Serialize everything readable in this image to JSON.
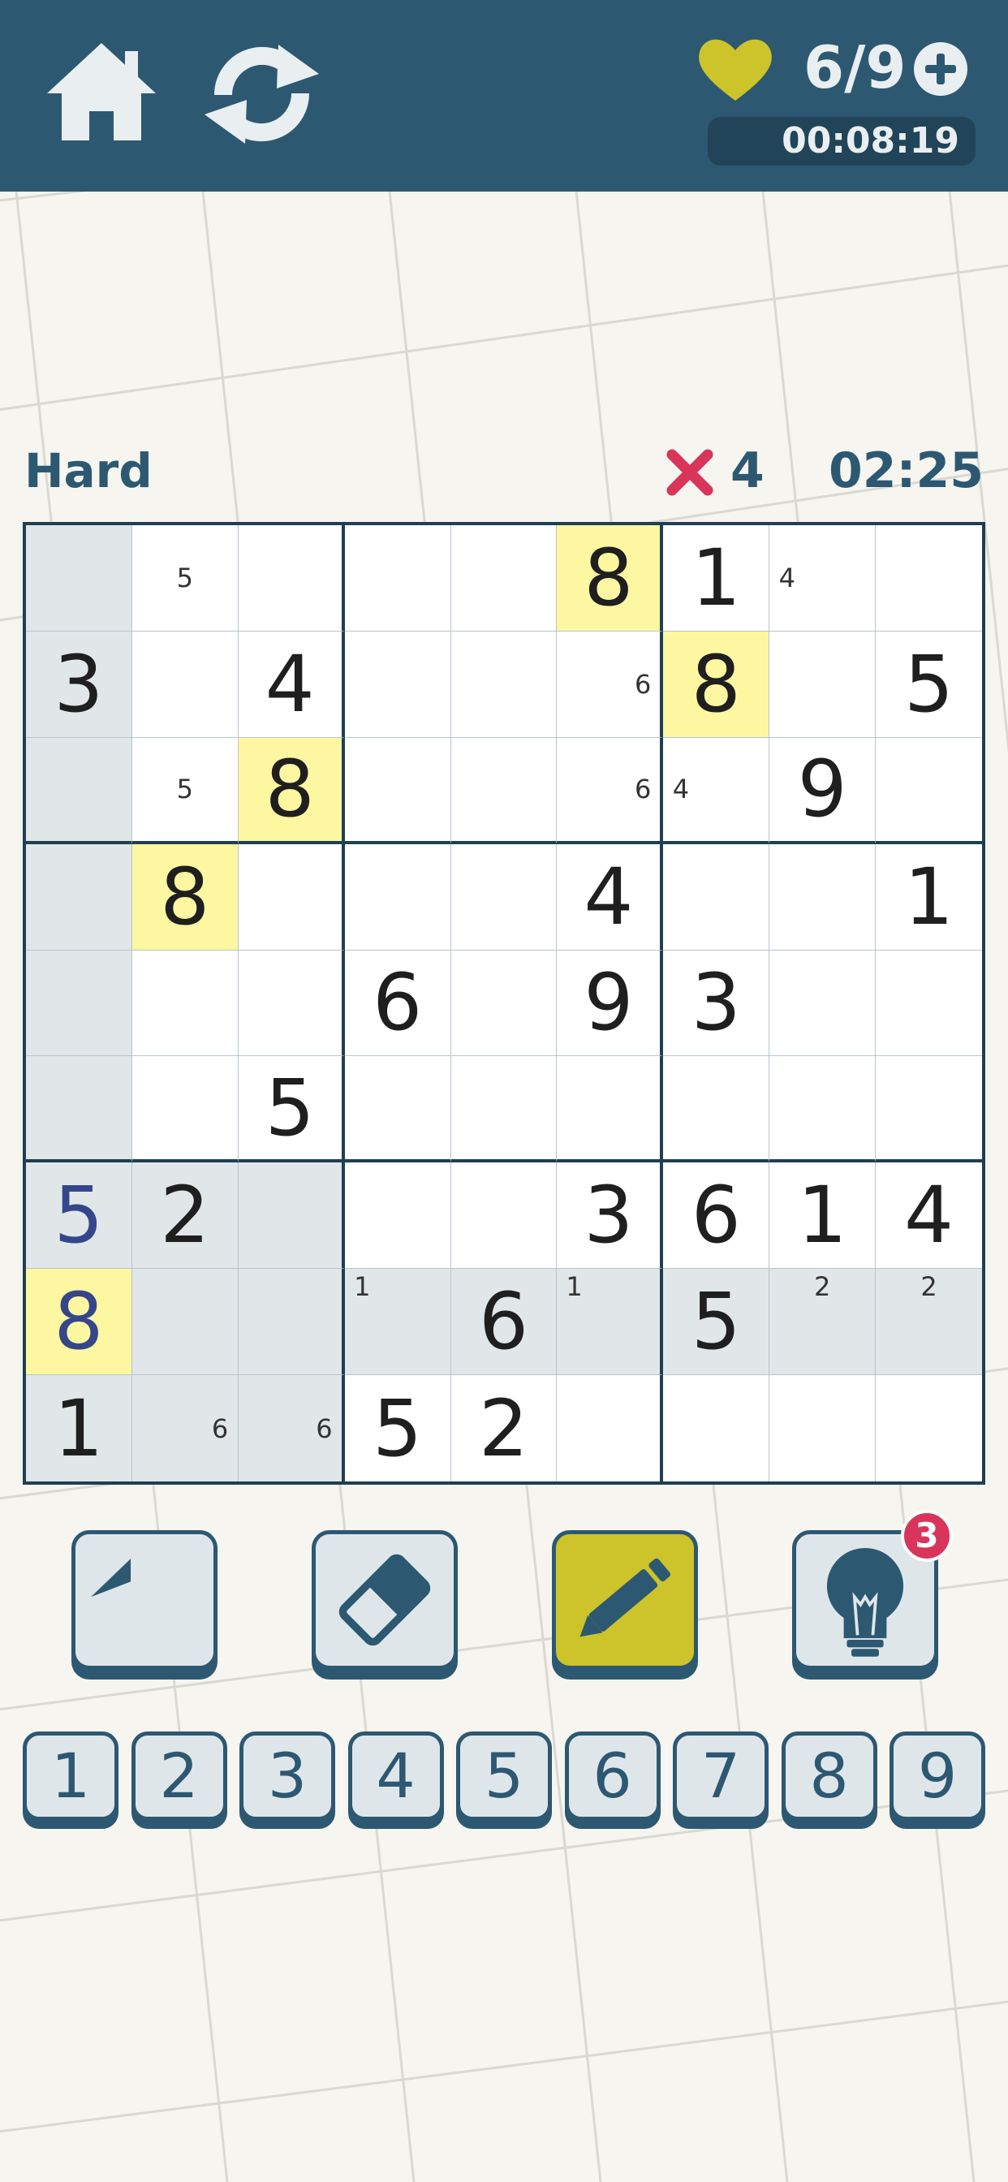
{
  "header": {
    "lives": "6/9",
    "session_timer": "00:08:19"
  },
  "status": {
    "difficulty": "Hard",
    "mistakes": "4",
    "clock": "02:25"
  },
  "colors": {
    "header_bg": "#2d5872",
    "heart": "#cdc32a",
    "mistake_x": "#d9345a",
    "highlight": "#fcf7a0",
    "shade": "#e1e6e9",
    "user_digit": "#35468a"
  },
  "board": {
    "rows": [
      [
        {
          "v": "",
          "s": 1
        },
        {
          "v": "",
          "n": [
            5
          ]
        },
        {
          "v": ""
        },
        {
          "v": ""
        },
        {
          "v": ""
        },
        {
          "v": "8",
          "h": 1
        },
        {
          "v": "1"
        },
        {
          "v": "",
          "n": [
            4
          ]
        },
        {
          "v": ""
        }
      ],
      [
        {
          "v": "3",
          "s": 1
        },
        {
          "v": ""
        },
        {
          "v": "4"
        },
        {
          "v": ""
        },
        {
          "v": ""
        },
        {
          "v": "",
          "n": [
            6
          ]
        },
        {
          "v": "8",
          "h": 1
        },
        {
          "v": ""
        },
        {
          "v": "5"
        }
      ],
      [
        {
          "v": "",
          "s": 1
        },
        {
          "v": "",
          "n": [
            5
          ]
        },
        {
          "v": "8",
          "h": 1
        },
        {
          "v": ""
        },
        {
          "v": ""
        },
        {
          "v": "",
          "n": [
            6
          ]
        },
        {
          "v": "",
          "n": [
            4
          ]
        },
        {
          "v": "9"
        },
        {
          "v": ""
        }
      ],
      [
        {
          "v": "",
          "s": 1
        },
        {
          "v": "8",
          "h": 1
        },
        {
          "v": ""
        },
        {
          "v": ""
        },
        {
          "v": ""
        },
        {
          "v": "4"
        },
        {
          "v": ""
        },
        {
          "v": ""
        },
        {
          "v": "1"
        }
      ],
      [
        {
          "v": "",
          "s": 1
        },
        {
          "v": ""
        },
        {
          "v": ""
        },
        {
          "v": "6"
        },
        {
          "v": ""
        },
        {
          "v": "9"
        },
        {
          "v": "3"
        },
        {
          "v": ""
        },
        {
          "v": ""
        }
      ],
      [
        {
          "v": "",
          "s": 1
        },
        {
          "v": ""
        },
        {
          "v": "5"
        },
        {
          "v": ""
        },
        {
          "v": ""
        },
        {
          "v": ""
        },
        {
          "v": ""
        },
        {
          "v": ""
        },
        {
          "v": ""
        }
      ],
      [
        {
          "v": "5",
          "s": 1,
          "u": 1
        },
        {
          "v": "2",
          "s": 1
        },
        {
          "v": "",
          "s": 1
        },
        {
          "v": ""
        },
        {
          "v": ""
        },
        {
          "v": "3"
        },
        {
          "v": "6"
        },
        {
          "v": "1"
        },
        {
          "v": "4"
        }
      ],
      [
        {
          "v": "8",
          "h": 1,
          "u": 1
        },
        {
          "v": "",
          "s": 1
        },
        {
          "v": "",
          "s": 1
        },
        {
          "v": "",
          "s": 1,
          "n": [
            1
          ]
        },
        {
          "v": "6",
          "s": 1
        },
        {
          "v": "",
          "s": 1,
          "n": [
            1
          ]
        },
        {
          "v": "5",
          "s": 1
        },
        {
          "v": "",
          "s": 1,
          "n": [
            2
          ]
        },
        {
          "v": "",
          "s": 1,
          "n": [
            2
          ]
        }
      ],
      [
        {
          "v": "1",
          "s": 1
        },
        {
          "v": "",
          "s": 1,
          "n": [
            6
          ]
        },
        {
          "v": "",
          "s": 1,
          "n": [
            6
          ]
        },
        {
          "v": "5"
        },
        {
          "v": "2"
        },
        {
          "v": ""
        },
        {
          "v": ""
        },
        {
          "v": ""
        },
        {
          "v": ""
        }
      ]
    ]
  },
  "tools": {
    "undo_icon": "undo-arrow-icon",
    "erase_icon": "eraser-icon",
    "notes_icon": "pencil-icon",
    "hint_icon": "lightbulb-icon",
    "hint_count": "3"
  },
  "numpad": [
    "1",
    "2",
    "3",
    "4",
    "5",
    "6",
    "7",
    "8",
    "9"
  ]
}
